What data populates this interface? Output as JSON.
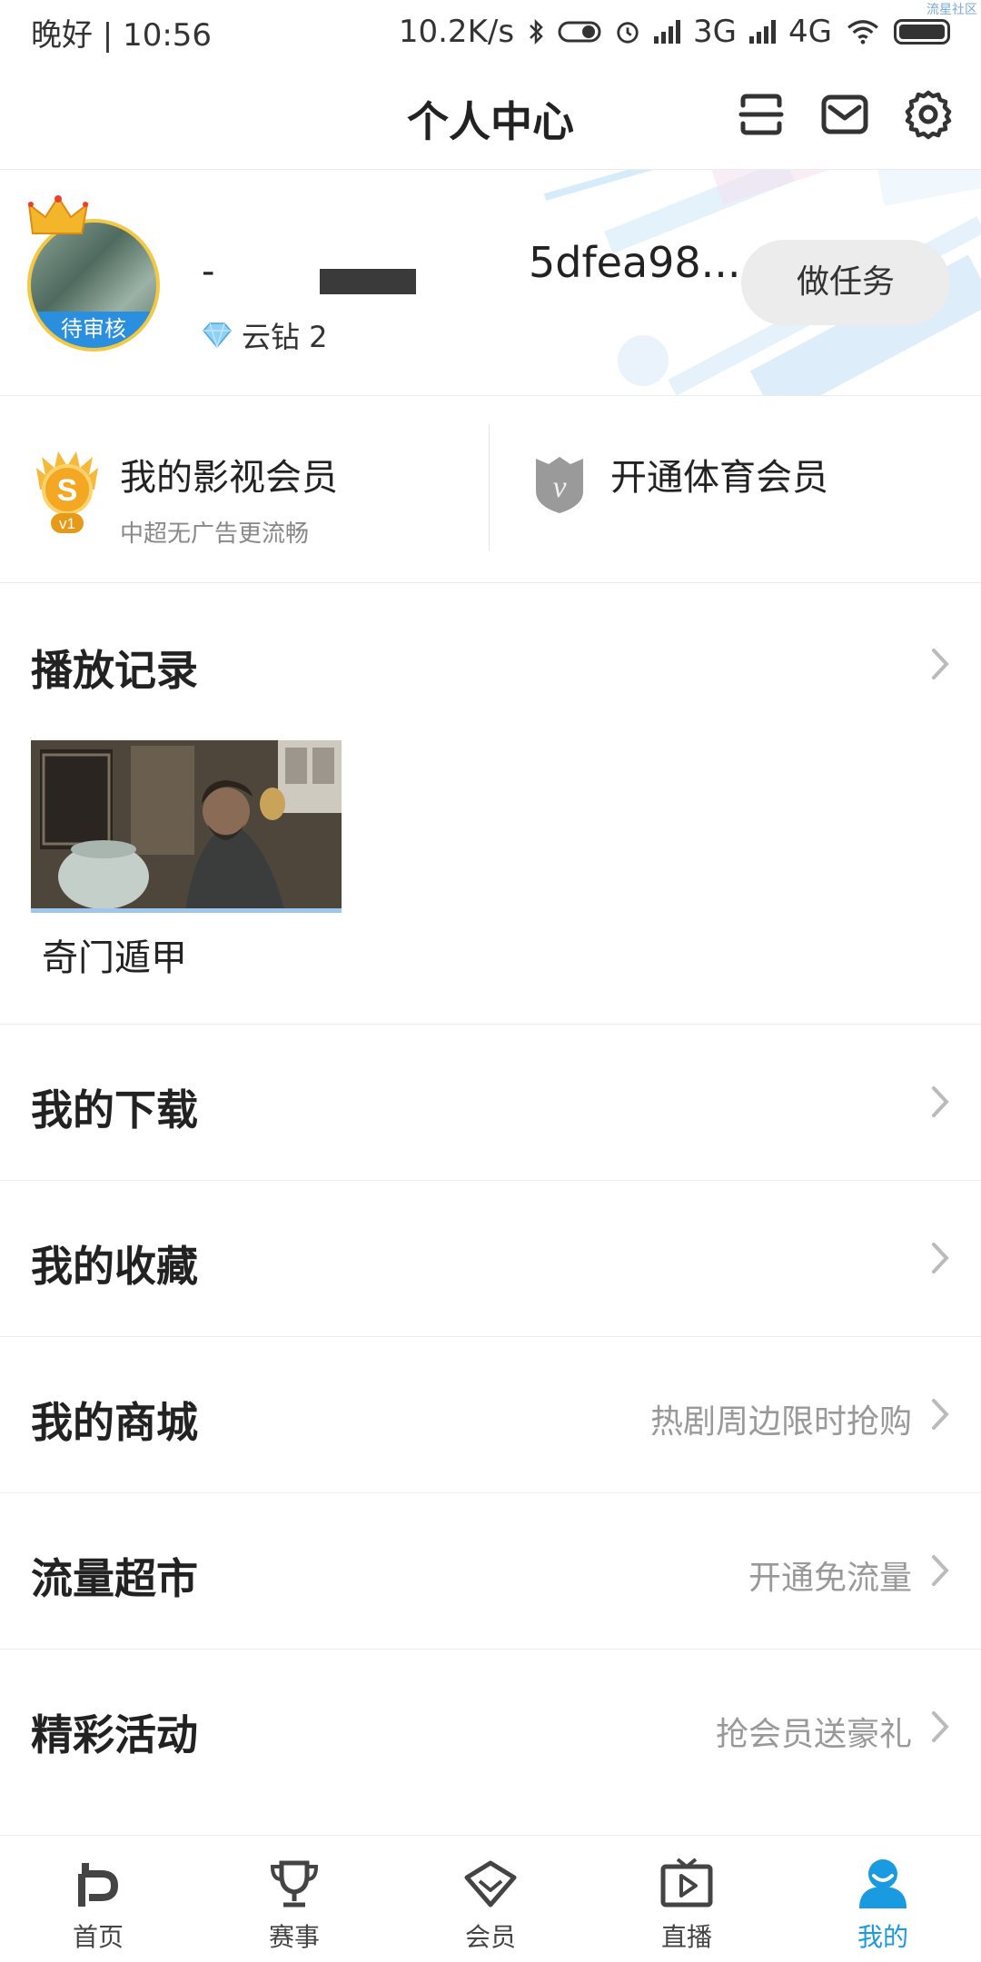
{
  "status_bar": {
    "left_text": "晚好 | 10:56",
    "net_speed": "10.2K/s",
    "net_3g": "3G",
    "net_4g": "4G",
    "watermark": "流星社区"
  },
  "header": {
    "title": "个人中心"
  },
  "profile": {
    "avatar_badge": "待审核",
    "name_prefix": "-",
    "name_suffix": "5dfea98...",
    "diamond_label": "云钻 2",
    "task_button": "做任务"
  },
  "membership": {
    "video_title": "我的影视会员",
    "video_sub": "中超无广告更流畅",
    "video_level": "v1",
    "sports_title": "开通体育会员"
  },
  "history": {
    "title": "播放记录",
    "items": [
      {
        "title": "奇门遁甲"
      }
    ]
  },
  "menu": [
    {
      "title": "我的下载",
      "note": ""
    },
    {
      "title": "我的收藏",
      "note": ""
    },
    {
      "title": "我的商城",
      "note": "热剧周边限时抢购"
    },
    {
      "title": "流量超市",
      "note": "开通免流量"
    },
    {
      "title": "精彩活动",
      "note": "抢会员送豪礼"
    }
  ],
  "bottom_nav": [
    {
      "label": "首页",
      "icon": "pp-logo-icon",
      "active": false
    },
    {
      "label": "赛事",
      "icon": "trophy-icon",
      "active": false
    },
    {
      "label": "会员",
      "icon": "diamond-icon",
      "active": false
    },
    {
      "label": "直播",
      "icon": "tv-play-icon",
      "active": false
    },
    {
      "label": "我的",
      "icon": "user-icon",
      "active": true
    }
  ],
  "colors": {
    "accent": "#1a9ae0",
    "avatar_badge": "#2b8fe0",
    "crown": "#f3b52a"
  }
}
